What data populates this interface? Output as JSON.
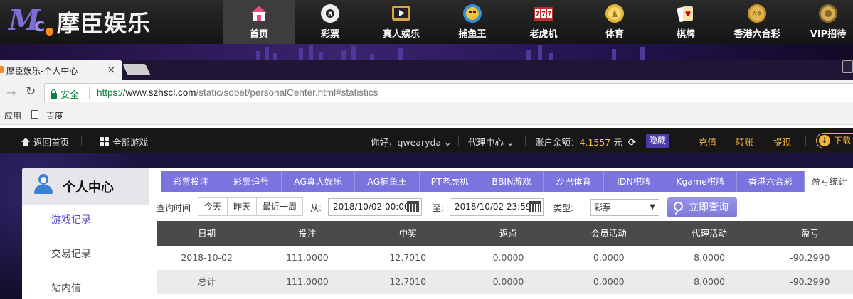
{
  "site": {
    "logo_text": "摩臣娱乐",
    "nav": [
      {
        "label": "首页",
        "icon": "home-icon"
      },
      {
        "label": "彩票",
        "icon": "lottery-ball-icon"
      },
      {
        "label": "真人娱乐",
        "icon": "live-casino-icon"
      },
      {
        "label": "捕鱼王",
        "icon": "fish-icon"
      },
      {
        "label": "老虎机",
        "icon": "slot-machine-icon"
      },
      {
        "label": "体育",
        "icon": "sports-icon"
      },
      {
        "label": "棋牌",
        "icon": "cards-icon"
      },
      {
        "label": "香港六合彩",
        "icon": "mark-six-icon"
      },
      {
        "label": "VIP招待",
        "icon": "vip-icon"
      }
    ]
  },
  "browser": {
    "tab_title": "摩臣娱乐-个人中心",
    "tab_close": "×",
    "secure_label": "安全",
    "url_scheme": "https://",
    "url_host": "www.szhscl.com",
    "url_path": "/static/sobet/personalCenter.html#statistics",
    "bookmarks": {
      "apps": "应用",
      "baidu": "百度"
    }
  },
  "userbar": {
    "home": "返回首页",
    "all_games": "全部游戏",
    "greeting": "你好，qwearyda",
    "agent": "代理中心",
    "balance_label": "账户余额：",
    "balance_value": "4.1557",
    "balance_unit": "元",
    "hide": "隐藏",
    "recharge": "充值",
    "transfer": "转账",
    "withdraw": "提现",
    "download": "下载"
  },
  "sidebar": {
    "title": "个人中心",
    "items": [
      "游戏记录",
      "交易记录",
      "站内信"
    ]
  },
  "tabs": [
    "彩票投注",
    "彩票追号",
    "AG真人娱乐",
    "AG捕鱼王",
    "PT老虎机",
    "BBIN游戏",
    "沙巴体育",
    "IDN棋牌",
    "Kgame棋牌",
    "香港六合彩",
    "盈亏统计"
  ],
  "filter": {
    "time_label": "查询时间",
    "quick": [
      "今天",
      "昨天",
      "最近一周"
    ],
    "from_label": "从:",
    "from_value": "2018/10/02 00:00",
    "to_label": "至:",
    "to_value": "2018/10/02 23:59",
    "type_label": "类型:",
    "type_value": "彩票",
    "query_button": "立即查询"
  },
  "table": {
    "headers": [
      "日期",
      "投注",
      "中奖",
      "返点",
      "会员活动",
      "代理活动",
      "盈亏"
    ],
    "rows": [
      [
        "2018-10-02",
        "111.0000",
        "12.7010",
        "0.0000",
        "0.0000",
        "8.0000",
        "-90.2990"
      ],
      [
        "总计",
        "111.0000",
        "12.7010",
        "0.0000",
        "0.0000",
        "8.0000",
        "-90.2990"
      ]
    ]
  },
  "colors": {
    "accent_purple": "#7b73de",
    "balance_gold": "#f0c23c",
    "secure_green": "#0b8043"
  }
}
